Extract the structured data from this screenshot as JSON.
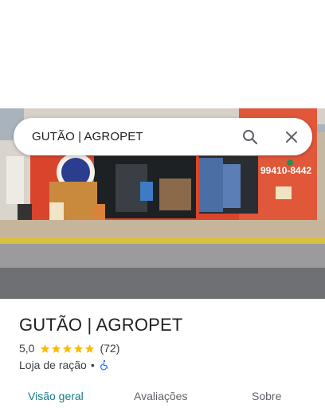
{
  "search": {
    "query": "GUTÃO | AGROPET"
  },
  "photo": {
    "description_icon": "storefront-photo",
    "storefront_phone": "99410-8442"
  },
  "place": {
    "name": "GUTÃO | AGROPET",
    "rating": "5,0",
    "stars": 5,
    "review_count": "(72)",
    "category": "Loja de ração",
    "separator": "•",
    "accessibility_icon": "wheelchair-icon"
  },
  "tabs": [
    {
      "label": "Visão geral",
      "active": true
    },
    {
      "label": "Avaliações",
      "active": false
    },
    {
      "label": "Sobre",
      "active": false
    }
  ],
  "colors": {
    "star": "#fbbc04",
    "active_tab": "#137b88",
    "accessibility": "#1a73e8"
  }
}
